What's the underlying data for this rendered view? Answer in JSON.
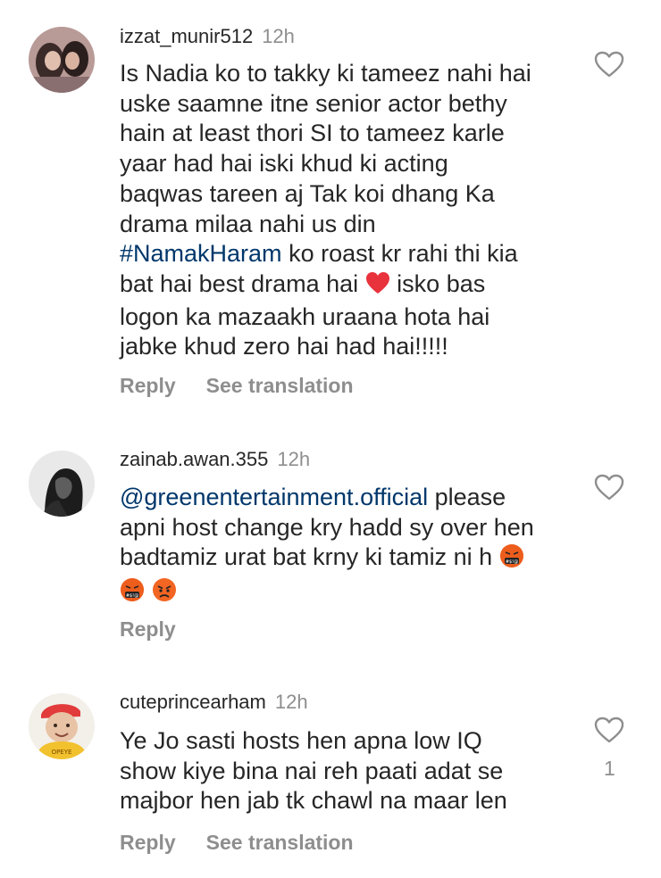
{
  "comments": [
    {
      "username": "izzat_munir512",
      "time": "12h",
      "lines": [
        "Is Nadia ko to takky ki tameez nahi hai",
        "uske saamne itne senior actor bethy",
        "hain at least thori SI to tameez karle",
        "yaar had hai iski khud ki acting",
        "baqwas tareen aj Tak koi dhang Ka",
        "drama milaa nahi us din"
      ],
      "hashtag": "#NamakHaram",
      "line7_rest": " ko roast kr rahi thi kia",
      "line8": "bat hai best drama hai ",
      "line8_after": " isko bas",
      "line9": "logon ka mazaakh uraana hota hai",
      "line10": "jabke khud zero hai had hai!!!!!",
      "reply_label": "Reply",
      "translate_label": "See translation",
      "emoji": "red-heart-emoji"
    },
    {
      "username": "zainab.awan.355",
      "time": "12h",
      "mention": "@greenentertainment.official",
      "mention_rest": " please",
      "lines": [
        "apni host change kry hadd sy over hen",
        "badtamiz urat bat krny ki tamiz ni h "
      ],
      "reply_label": "Reply",
      "emojis": [
        "face-with-symbols-emoji",
        "face-with-symbols-emoji",
        "angry-face-emoji"
      ]
    },
    {
      "username": "cuteprincearham",
      "time": "12h",
      "lines": [
        "Ye Jo sasti hosts hen apna low IQ",
        "show kiye bina nai reh paati adat se",
        "majbor hen jab tk chawl na maar len"
      ],
      "likes": "1",
      "reply_label": "Reply",
      "translate_label": "See translation"
    }
  ],
  "colors": {
    "text": "#262626",
    "secondary": "#8e8e8e",
    "link": "#00376b",
    "heart_emoji": "#e8323c",
    "angry_emoji": "#e64a19"
  }
}
